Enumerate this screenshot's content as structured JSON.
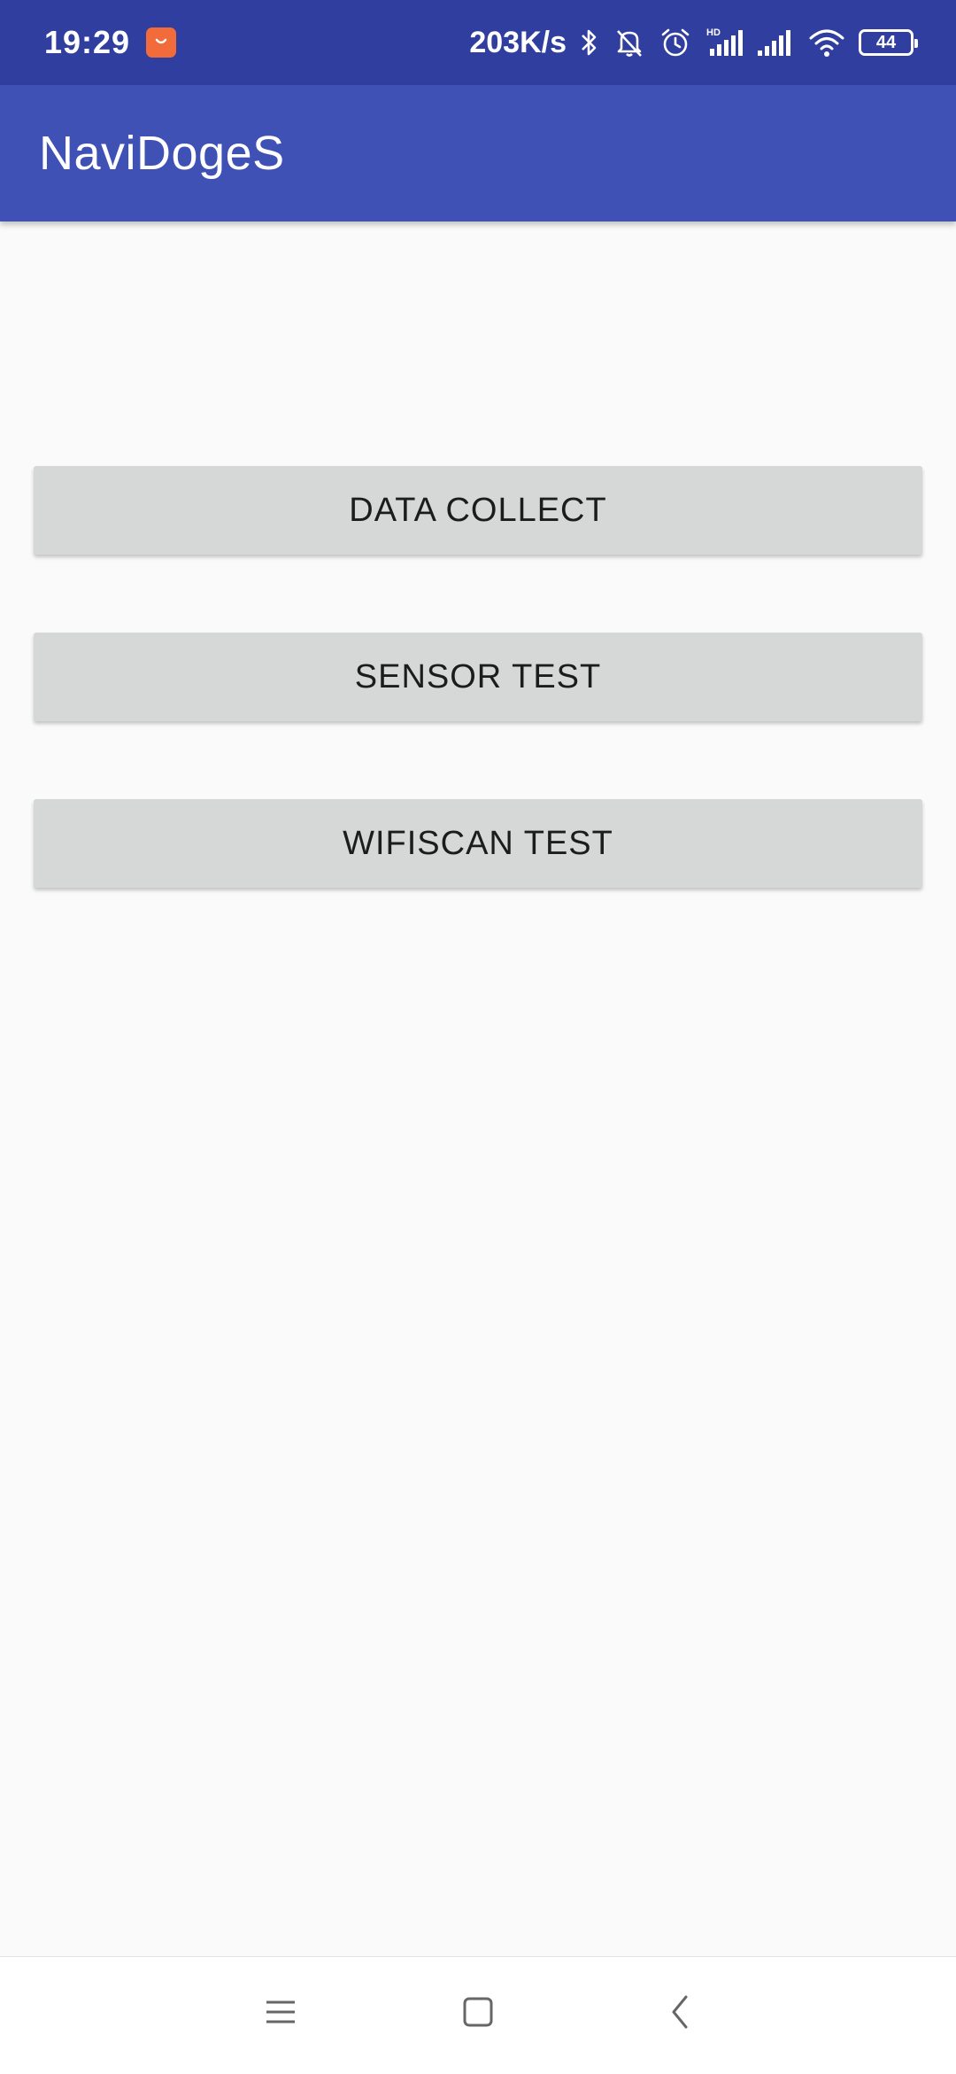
{
  "status_bar": {
    "time": "19:29",
    "app_icon": "mi-app-store-icon",
    "network_speed": "203K/s",
    "icons": [
      "bluetooth-icon",
      "mute-bell-icon",
      "alarm-icon",
      "signal-hd-icon",
      "signal-icon",
      "wifi-icon"
    ],
    "battery_level": "44",
    "background_color": "#303f9f"
  },
  "toolbar": {
    "title": "NaviDogeS",
    "background_color": "#3f51b5"
  },
  "main": {
    "buttons": [
      {
        "label": "DATA COLLECT"
      },
      {
        "label": "SENSOR TEST"
      },
      {
        "label": "WIFISCAN TEST"
      }
    ]
  },
  "nav_bar": {
    "items": [
      "menu-icon",
      "home-icon",
      "back-icon"
    ]
  },
  "colors": {
    "background": "#fafafa",
    "button": "#d6d7d7",
    "button_text": "#1c1c1c"
  }
}
